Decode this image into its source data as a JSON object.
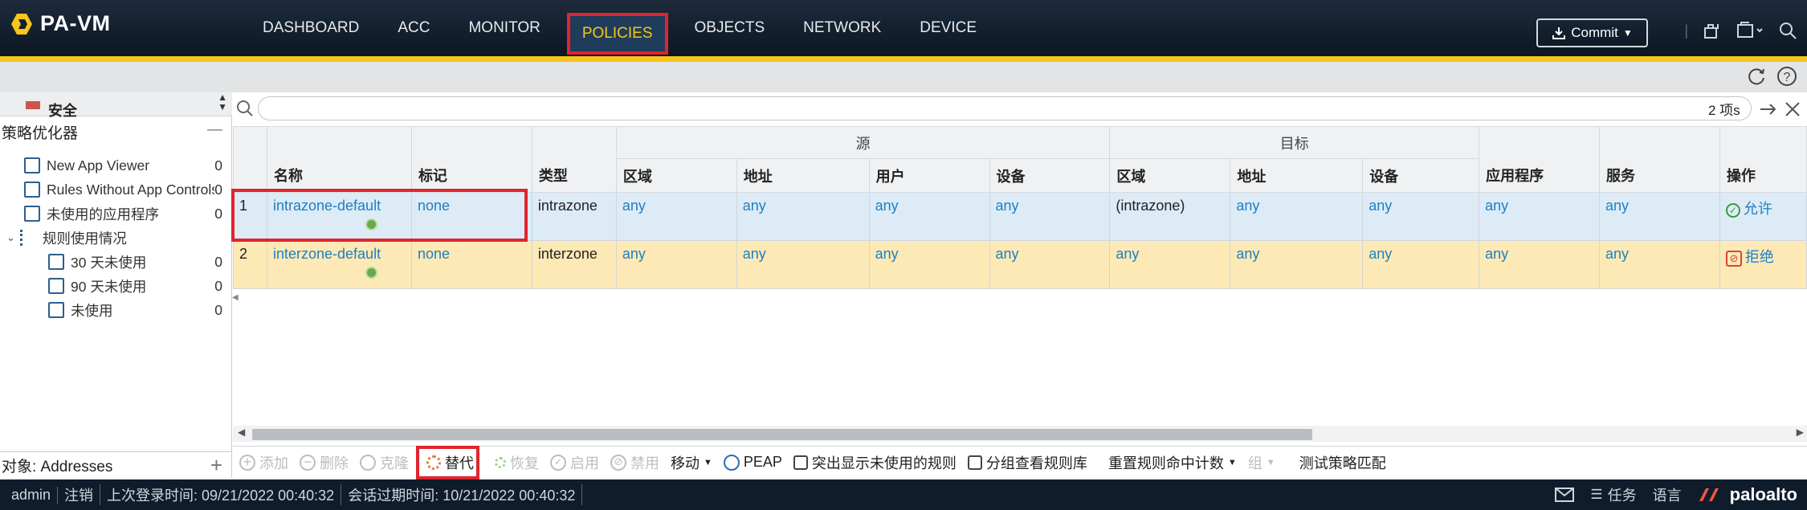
{
  "app": {
    "logo": "PA-VM"
  },
  "nav": [
    {
      "label": "DASHBOARD"
    },
    {
      "label": "ACC"
    },
    {
      "label": "MONITOR"
    },
    {
      "label": "POLICIES"
    },
    {
      "label": "OBJECTS"
    },
    {
      "label": "NETWORK"
    },
    {
      "label": "DEVICE"
    }
  ],
  "header": {
    "commit_label": "Commit"
  },
  "left_panel": {
    "top_item": "安全",
    "optimizer": "策略优化器",
    "optimizer_collapse": "—",
    "items": [
      {
        "label": "New App Viewer",
        "count": "0"
      },
      {
        "label": "Rules Without App Controls",
        "count": "0"
      },
      {
        "label": "未使用的应用程序",
        "count": "0"
      },
      {
        "label": "规则使用情况"
      },
      {
        "label": "30 天未使用",
        "count": "0"
      },
      {
        "label": "90 天未使用",
        "count": "0"
      },
      {
        "label": "未使用",
        "count": "0"
      }
    ],
    "bottom_label": "对象: Addresses",
    "bottom_plus": "+"
  },
  "search": {
    "count": "2 项s",
    "placeholder": ""
  },
  "table": {
    "group_source": "源",
    "group_dest": "目标",
    "headers": {
      "name": "名称",
      "tag": "标记",
      "type": "类型",
      "src_zone": "区域",
      "src_addr": "地址",
      "src_user": "用户",
      "src_device": "设备",
      "dst_zone": "区域",
      "dst_addr": "地址",
      "dst_device": "设备",
      "application": "应用程序",
      "service": "服务",
      "action": "操作"
    },
    "rows": [
      {
        "num": "1",
        "name": "intrazone-default",
        "tag": "none",
        "type": "intrazone",
        "src_zone": "any",
        "src_addr": "any",
        "src_user": "any",
        "src_device": "any",
        "dst_zone": "(intrazone)",
        "dst_addr": "any",
        "dst_device": "any",
        "application": "any",
        "service": "any",
        "action": "允许"
      },
      {
        "num": "2",
        "name": "interzone-default",
        "tag": "none",
        "type": "interzone",
        "src_zone": "any",
        "src_addr": "any",
        "src_user": "any",
        "src_device": "any",
        "dst_zone": "any",
        "dst_addr": "any",
        "dst_device": "any",
        "application": "any",
        "service": "any",
        "action": "拒绝"
      }
    ]
  },
  "toolbar": {
    "add": "添加",
    "delete": "删除",
    "clone": "克隆",
    "override": "替代",
    "revert": "恢复",
    "enable": "启用",
    "disable": "禁用",
    "move": "移动",
    "peap": "PEAP",
    "highlight_unused": "突出显示未使用的规则",
    "group_view": "分组查看规则库",
    "reset_hit": "重置规则命中计数",
    "group": "组",
    "test_match": "测试策略匹配"
  },
  "footer": {
    "user": "admin",
    "logout": "注销",
    "last_login": "上次登录时间: 09/21/2022 00:40:32",
    "session_expire": "会话过期时间:  10/21/2022 00:40:32",
    "tasks": "任务",
    "language": "语言",
    "brand": "paloalto"
  },
  "colors": {
    "accent": "#f7c51b",
    "highlight": "#e0242f",
    "link": "#1f7fc1",
    "row1": "#dcebf6",
    "row2": "#fde9b6"
  }
}
